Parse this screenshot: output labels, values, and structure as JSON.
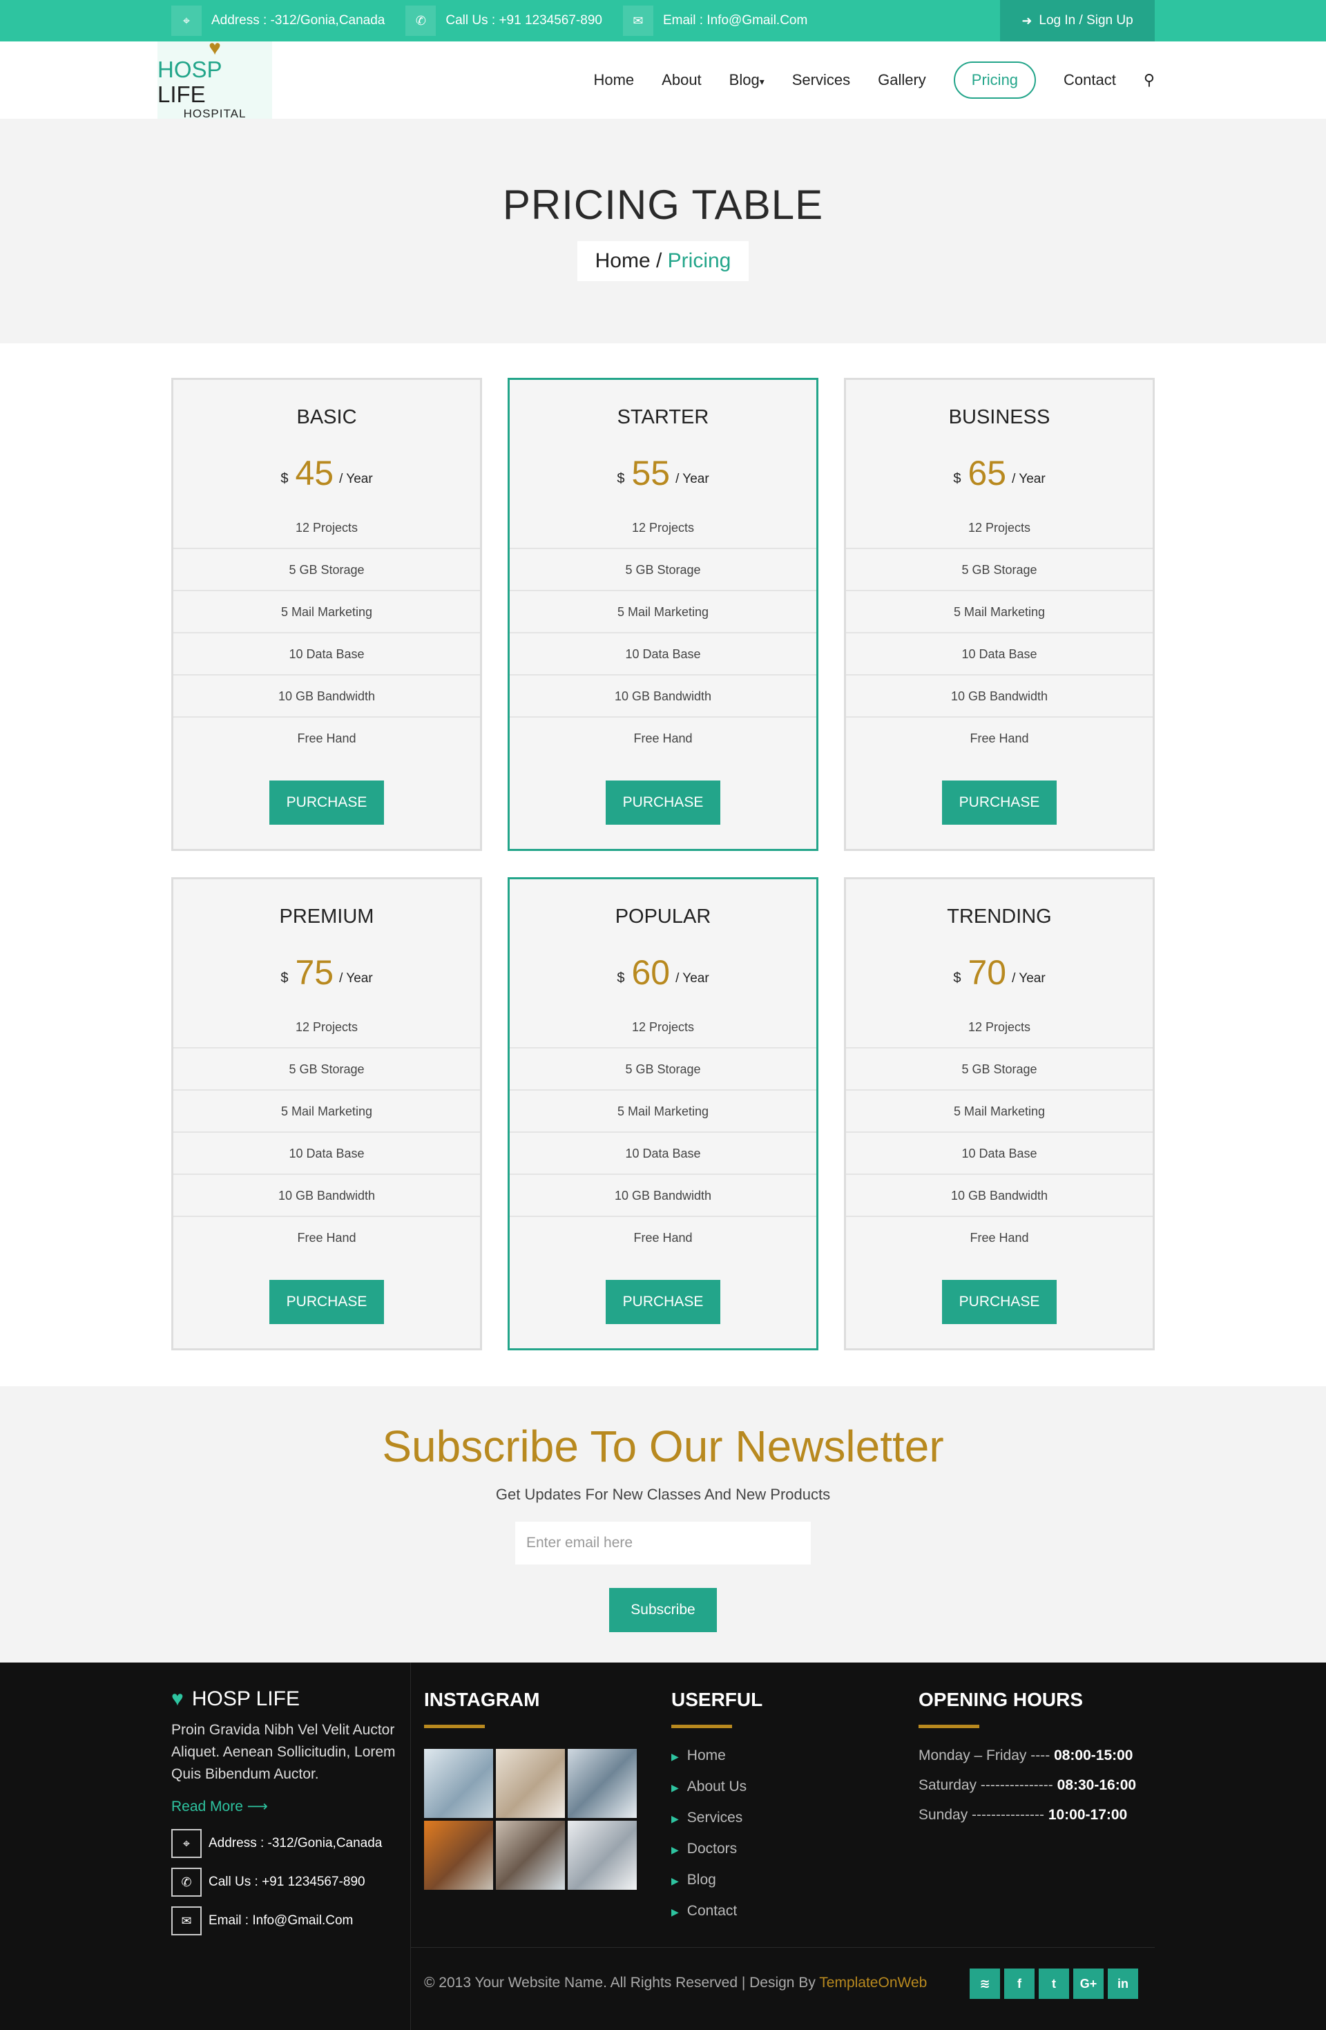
{
  "topbar": {
    "address": "Address : -312/Gonia,Canada",
    "phone": "Call Us : +91 1234567-890",
    "email": "Email : Info@Gmail.Com",
    "login": "Log In / Sign Up"
  },
  "logo": {
    "part1": "HOSP",
    "part2": " LIFE",
    "sub": "HOSPITAL"
  },
  "nav": {
    "items": [
      "Home",
      "About",
      "Blog",
      "Services",
      "Gallery",
      "Pricing",
      "Contact"
    ],
    "blog_caret": "▾",
    "active": "Pricing"
  },
  "banner": {
    "title": "PRICING TABLE",
    "crumb_home": "Home",
    "crumb_sep": " / ",
    "crumb_current": "Pricing"
  },
  "pricing": {
    "currency": "$",
    "period": "/ Year",
    "purchase_label": "PURCHASE",
    "features": [
      "12 Projects",
      "5 GB Storage",
      "5 Mail Marketing",
      "10 Data Base",
      "10 GB Bandwidth",
      "Free Hand"
    ],
    "plans": [
      {
        "name": "BASIC",
        "price": "45",
        "featured": false
      },
      {
        "name": "STARTER",
        "price": "55",
        "featured": true
      },
      {
        "name": "BUSINESS",
        "price": "65",
        "featured": false
      },
      {
        "name": "PREMIUM",
        "price": "75",
        "featured": false
      },
      {
        "name": "POPULAR",
        "price": "60",
        "featured": true
      },
      {
        "name": "TRENDING",
        "price": "70",
        "featured": false
      }
    ]
  },
  "newsletter": {
    "title": "Subscribe To Our Newsletter",
    "subtitle": "Get Updates For New Classes And New Products",
    "placeholder": "Enter email here",
    "button": "Subscribe"
  },
  "footer": {
    "brand": "HOSP LIFE",
    "about": "Proin Gravida Nibh Vel Velit Auctor Aliquet. Aenean Sollicitudin, Lorem Quis Bibendum Auctor.",
    "read_more": "Read More",
    "address": "Address : -312/Gonia,Canada",
    "phone": "Call Us : +91 1234567-890",
    "email": "Email : Info@Gmail.Com",
    "instagram_title": "INSTAGRAM",
    "links_title": "USERFUL",
    "links": [
      "Home",
      "About Us",
      "Services",
      "Doctors",
      "Blog",
      "Contact"
    ],
    "hours_title": "OPENING HOURS",
    "hours": [
      {
        "day": "Monday – Friday ----",
        "time": "08:00-15:00"
      },
      {
        "day": "Saturday ---------------",
        "time": "08:30-16:00"
      },
      {
        "day": "Sunday ---------------",
        "time": "10:00-17:00"
      }
    ],
    "copyright": "© 2013 Your Website Name. All Rights Reserved | Design By ",
    "design_brand": "TemplateOnWeb",
    "socials": [
      "rss",
      "f",
      "t",
      "G+",
      "in"
    ]
  },
  "colors": {
    "accent": "#23a58a",
    "topbar": "#2ec4a0",
    "gold": "#b8891f",
    "footer_bg": "#111111"
  }
}
